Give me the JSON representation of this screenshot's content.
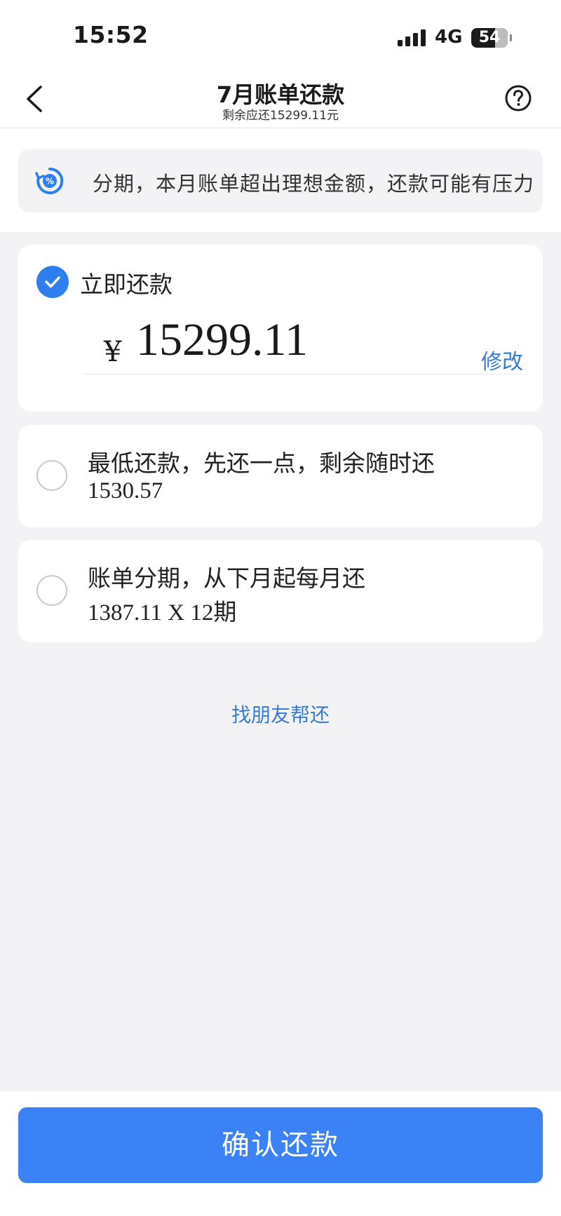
{
  "status_bar": {
    "time": "15:52",
    "network": "4G",
    "battery": "54"
  },
  "nav": {
    "title": "7月账单还款",
    "subtitle": "剩余应还15299.11元"
  },
  "banner": {
    "text": "分期，本月账单超出理想金额，还款可能有压力"
  },
  "options": {
    "immediate": {
      "label": "立即还款",
      "currency": "¥",
      "amount": "15299.11",
      "modify_label": "修改",
      "selected": true
    },
    "minimum": {
      "label": "最低还款，先还一点，剩余随时还",
      "amount": "1530.57",
      "selected": false
    },
    "installment": {
      "label": "账单分期，从下月起每月还",
      "amount": "1387.11 X 12期",
      "selected": false
    }
  },
  "friend_link": "找朋友帮还",
  "confirm_button": "确认还款",
  "colors": {
    "accent": "#3b82f6",
    "link": "#3a7bd5",
    "background": "#f3f3f5"
  }
}
